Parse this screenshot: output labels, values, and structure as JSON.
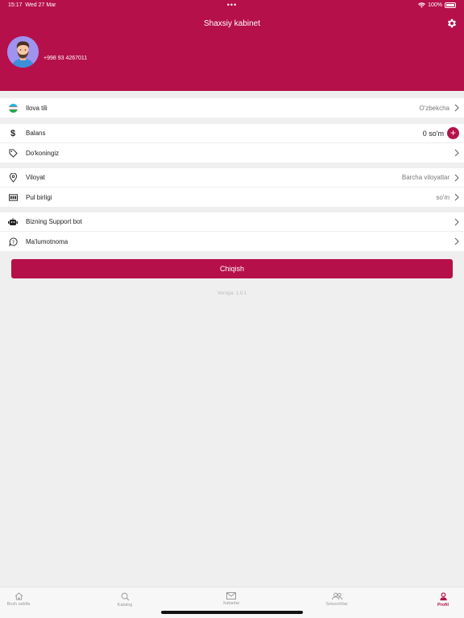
{
  "status_bar": {
    "time": "15:17",
    "date": "Wed 27 Mar",
    "battery": "100%"
  },
  "header": {
    "title": "Shaxsiy kabinet",
    "phone": "+998 93 4267011"
  },
  "settings": {
    "language_label": "Ilova tili",
    "language_value": "O'zbekcha",
    "balance_label": "Balans",
    "balance_value": "0 so'm",
    "shop_label": "Do'koningiz",
    "region_label": "Viloyat",
    "region_value": "Barcha viloyatlar",
    "currency_label": "Pul birligi",
    "currency_value": "so'm",
    "support_label": "Bizning Support bot",
    "info_label": "Ma'lumotnoma"
  },
  "logout_label": "Chiqish",
  "version": "Versiya: 1.0.1",
  "tabs": [
    {
      "label": "Bosh sahifa",
      "icon": "home-icon"
    },
    {
      "label": "Katalog",
      "icon": "search-icon"
    },
    {
      "label": "Xabarlar",
      "icon": "mail-icon"
    },
    {
      "label": "Sotuvchilar",
      "icon": "users-icon"
    },
    {
      "label": "Profil",
      "icon": "profile-icon"
    }
  ],
  "colors": {
    "accent": "#b5104a"
  }
}
